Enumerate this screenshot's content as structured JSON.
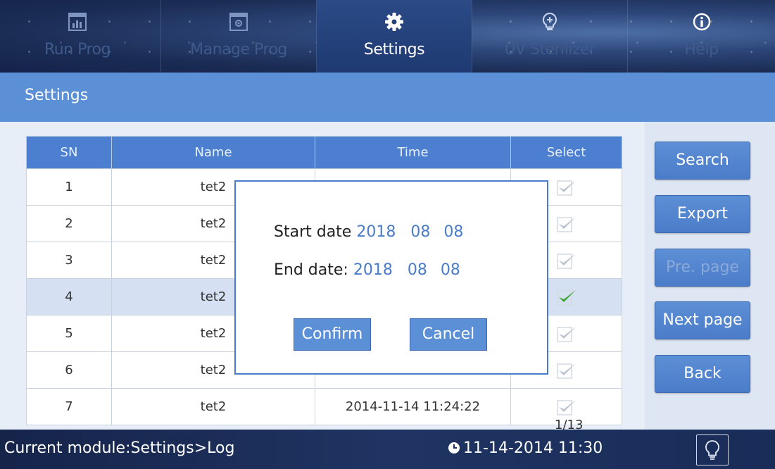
{
  "nav": {
    "tabs": [
      {
        "label": "Run Prog",
        "icon": "bar-chart-icon",
        "active": false
      },
      {
        "label": "Manage Prog",
        "icon": "manage-window-icon",
        "active": false
      },
      {
        "label": "Settings",
        "icon": "gear-icon",
        "active": true
      },
      {
        "label": "UV Sterilizer",
        "icon": "bulb-plus-icon",
        "active": false
      },
      {
        "label": "Help",
        "icon": "info-icon",
        "active": false
      }
    ]
  },
  "title": "Settings",
  "table": {
    "columns": [
      "SN",
      "Name",
      "Time",
      "Select"
    ],
    "rows": [
      {
        "sn": "1",
        "name": "tet2",
        "time": "",
        "checked": false
      },
      {
        "sn": "2",
        "name": "tet2",
        "time": "",
        "checked": false
      },
      {
        "sn": "3",
        "name": "tet2",
        "time": "",
        "checked": false
      },
      {
        "sn": "4",
        "name": "tet2",
        "time": "",
        "checked": true
      },
      {
        "sn": "5",
        "name": "tet2",
        "time": "",
        "checked": false
      },
      {
        "sn": "6",
        "name": "tet2",
        "time": "",
        "checked": false
      },
      {
        "sn": "7",
        "name": "tet2",
        "time": "2014-11-14   11:24:22",
        "checked": false
      }
    ],
    "page_indicator": "1/13"
  },
  "side_buttons": {
    "search": "Search",
    "export": "Export",
    "prev_page": "Pre. page",
    "next_page": "Next page",
    "back": "Back"
  },
  "dialog": {
    "start_label": "Start date",
    "start_year": "2018",
    "start_month": "08",
    "start_day": "08",
    "end_label": "End date:",
    "end_year": "2018",
    "end_month": "08",
    "end_day": "08",
    "confirm": "Confirm",
    "cancel": "Cancel"
  },
  "status": {
    "module": "Current module:Settings>Log",
    "datetime": "11-14-2014 11:30"
  },
  "colors": {
    "accent": "#5b8fd6",
    "header": "#4c7fd0",
    "check_active": "#3aa52a",
    "check_inactive": "#b9c3cf"
  }
}
